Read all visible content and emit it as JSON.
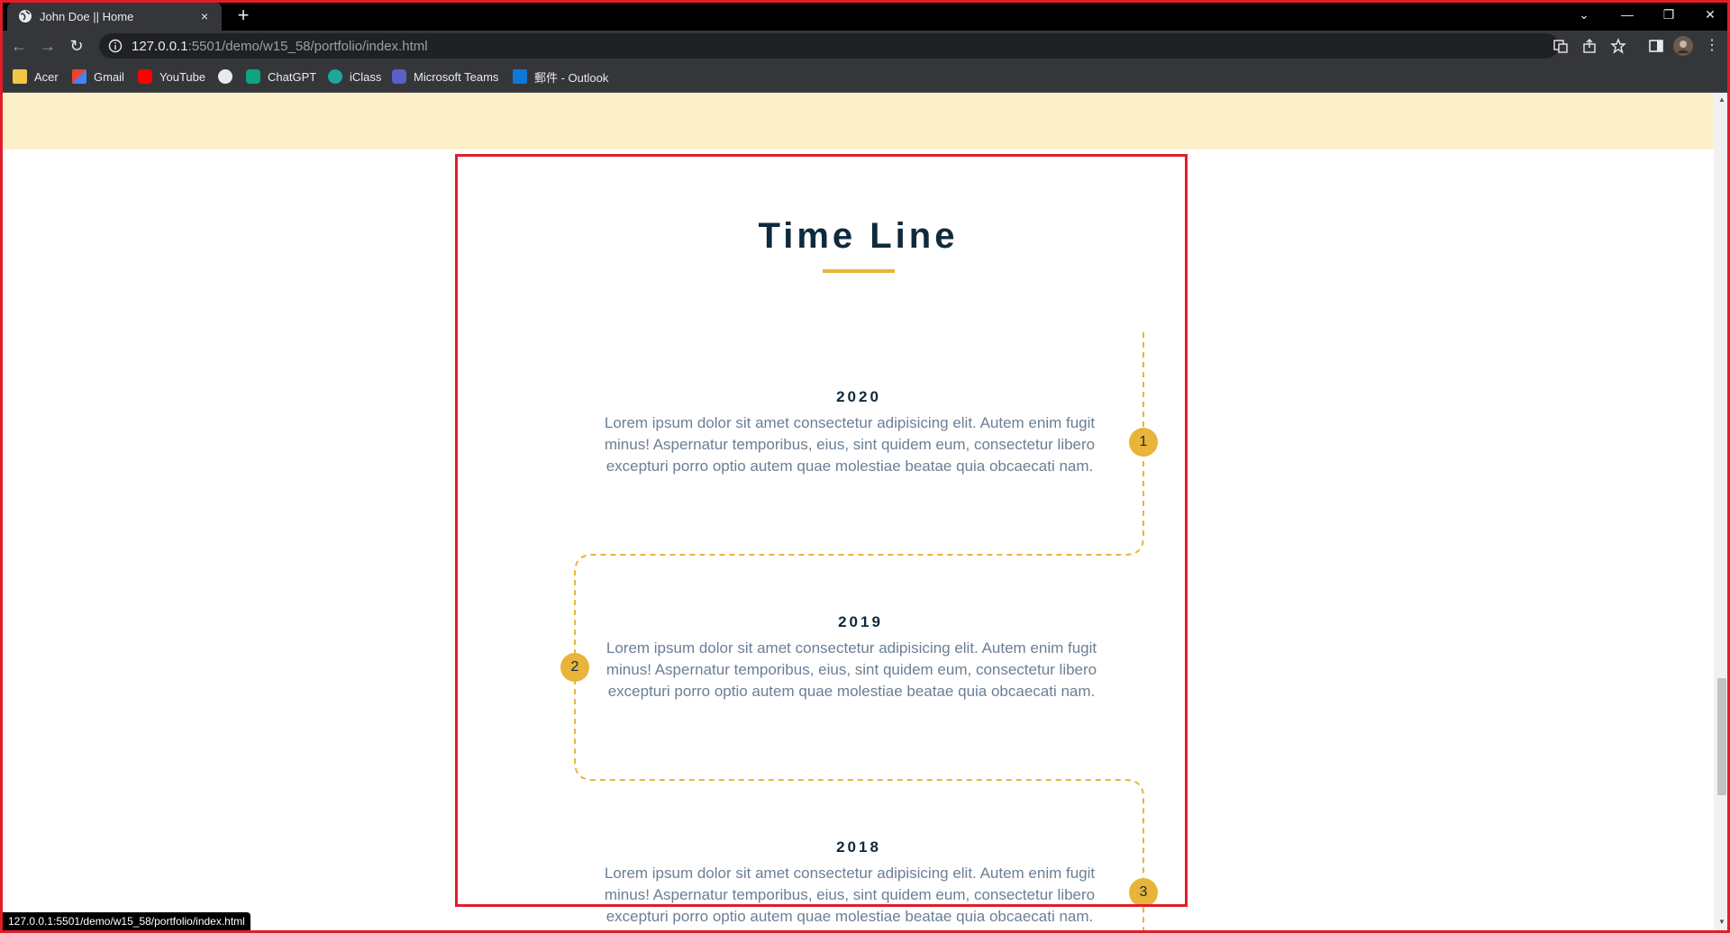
{
  "browser": {
    "tab_title": "John Doe || Home",
    "tab_close": "×",
    "new_tab": "+",
    "url_host": "127.0.0.1",
    "url_rest": ":5501/demo/w15_58/portfolio/index.html",
    "bookmarks": [
      "Acer",
      "Gmail",
      "YouTube",
      "",
      "ChatGPT",
      "iClass",
      "Microsoft Teams",
      "郵件 - Outlook"
    ],
    "status_url": "127.0.0.1:5501/demo/w15_58/portfolio/index.html"
  },
  "timeline": {
    "title": "Time Line",
    "accent_color": "#e8b53a",
    "items": [
      {
        "year": "2020",
        "badge": "1",
        "side": "right",
        "text": "Lorem ipsum dolor sit amet consectetur adipisicing elit. Autem enim fugit minus! Aspernatur temporibus, eius, sint quidem eum, consectetur libero excepturi porro optio autem quae molestiae beatae quia obcaecati nam."
      },
      {
        "year": "2019",
        "badge": "2",
        "side": "left",
        "text": "Lorem ipsum dolor sit amet consectetur adipisicing elit. Autem enim fugit minus! Aspernatur temporibus, eius, sint quidem eum, consectetur libero excepturi porro optio autem quae molestiae beatae quia obcaecati nam."
      },
      {
        "year": "2018",
        "badge": "3",
        "side": "right",
        "text": "Lorem ipsum dolor sit amet consectetur adipisicing elit. Autem enim fugit minus! Aspernatur temporibus, eius, sint quidem eum, consectetur libero excepturi porro optio autem quae molestiae beatae quia obcaecati nam."
      }
    ]
  }
}
